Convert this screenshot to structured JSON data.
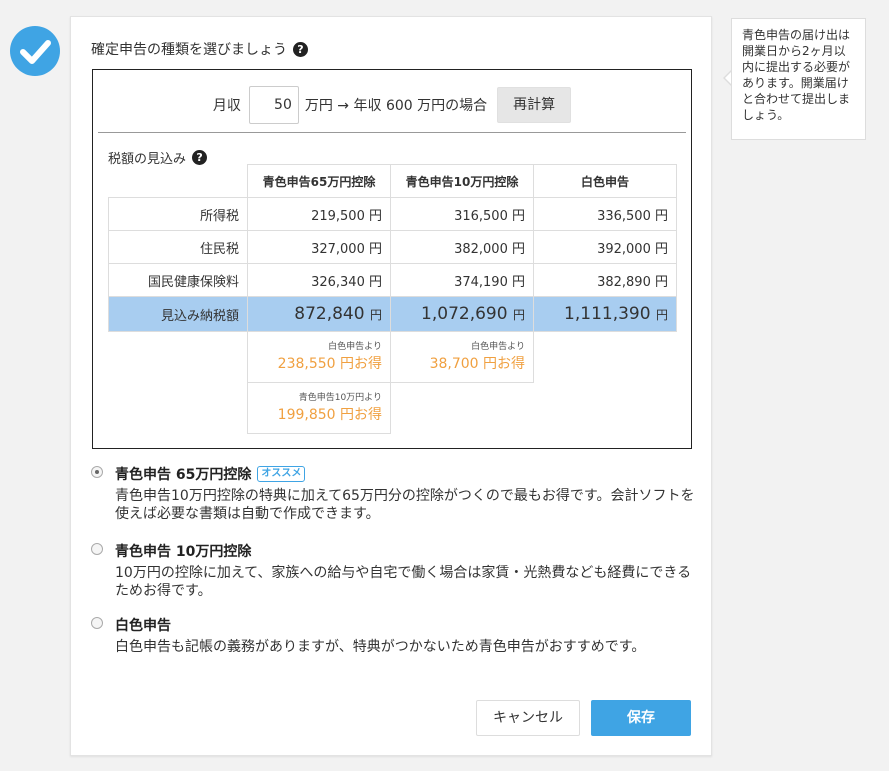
{
  "title": "確定申告の種類を選びましょう",
  "help_glyph": "?",
  "calc": {
    "monthly_label": "月収",
    "monthly_value": "50",
    "suffix": "万円 → 年収 600 万円の場合",
    "recalc_label": "再計算"
  },
  "tax_section_label": "税額の見込み",
  "table": {
    "headers": [
      "青色申告65万円控除",
      "青色申告10万円控除",
      "白色申告"
    ],
    "rows": [
      {
        "name": "所得税",
        "values": [
          "219,500 円",
          "316,500 円",
          "336,500 円"
        ]
      },
      {
        "name": "住民税",
        "values": [
          "327,000 円",
          "382,000 円",
          "392,000 円"
        ]
      },
      {
        "name": "国民健康保険料",
        "values": [
          "326,340 円",
          "374,190 円",
          "382,890 円"
        ]
      }
    ],
    "total": {
      "name": "見込み納税額",
      "values": [
        "872,840",
        "1,072,690",
        "1,111,390"
      ],
      "unit": "円"
    },
    "savings": [
      {
        "from": "白色申告より",
        "amount": "238,550 円お得"
      },
      {
        "from": "白色申告より",
        "amount": "38,700 円お得"
      },
      {
        "from": "青色申告10万円より",
        "amount": "199,850 円お得"
      }
    ]
  },
  "options": [
    {
      "title": "青色申告 65万円控除",
      "badge": "オススメ",
      "desc": "青色申告10万円控除の特典に加えて65万円分の控除がつくので最もお得です。会計ソフトを使えば必要な書類は自動で作成できます。",
      "checked": true
    },
    {
      "title": "青色申告 10万円控除",
      "badge": "",
      "desc": "10万円の控除に加えて、家族への給与や自宅で働く場合は家賃・光熱費なども経費にできるためお得です。",
      "checked": false
    },
    {
      "title": "白色申告",
      "badge": "",
      "desc": "白色申告も記帳の義務がありますが、特典がつかないため青色申告がおすすめです。",
      "checked": false
    }
  ],
  "buttons": {
    "cancel": "キャンセル",
    "save": "保存"
  },
  "tooltip": "青色申告の届け出は開業日から2ヶ月以内に提出する必要があります。開業届けと合わせて提出しましょう。",
  "colors": {
    "accent": "#3fa4e4",
    "total_row": "#a8cdf0",
    "savings": "#f0a040"
  }
}
